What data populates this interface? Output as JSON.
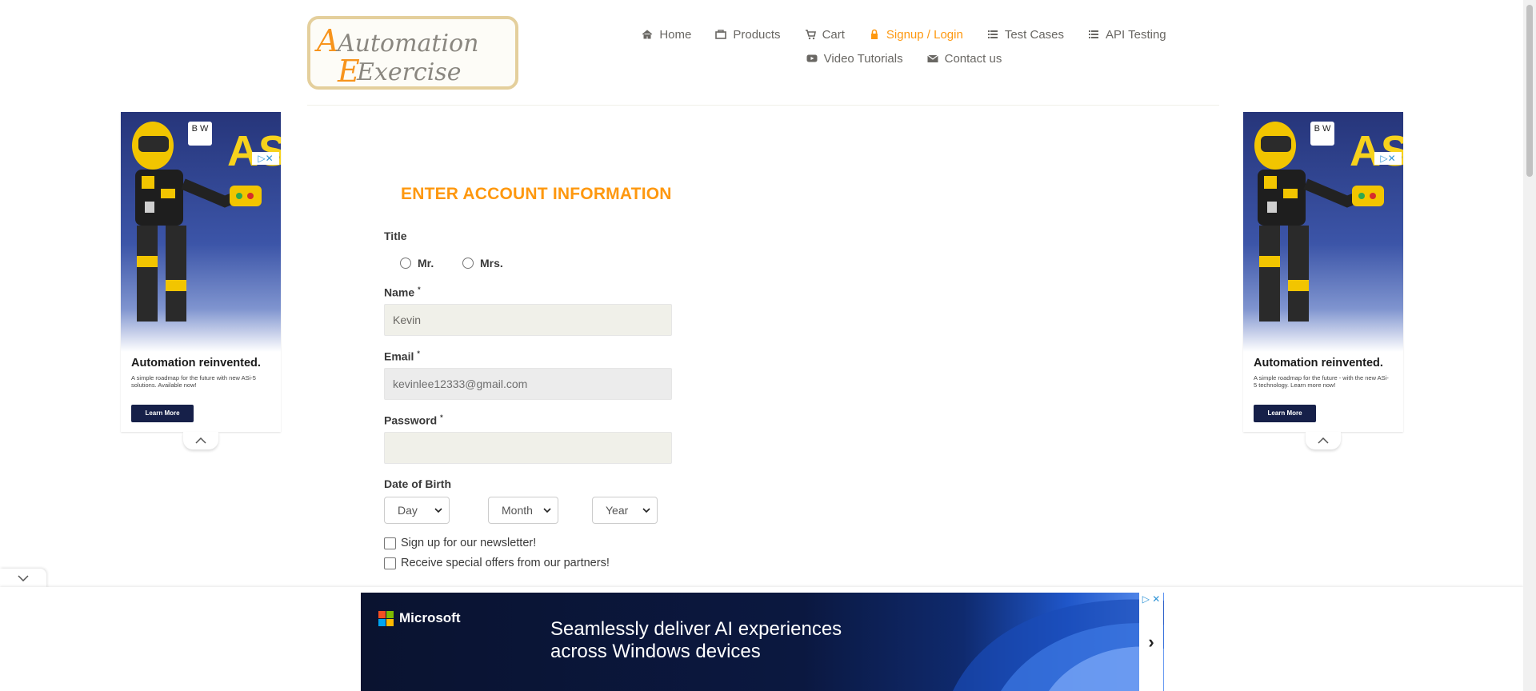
{
  "header": {
    "logo_text_line1": "Automation",
    "logo_text_line2": "Exercise",
    "nav": {
      "row1": [
        {
          "label": "Home",
          "icon": "home-icon"
        },
        {
          "label": "Products",
          "icon": "products-icon"
        },
        {
          "label": "Cart",
          "icon": "cart-icon"
        },
        {
          "label": "Signup / Login",
          "icon": "lock-icon",
          "active": true
        },
        {
          "label": "Test Cases",
          "icon": "list-icon"
        },
        {
          "label": "API Testing",
          "icon": "list-icon"
        }
      ],
      "row2": [
        {
          "label": "Video Tutorials",
          "icon": "youtube-icon"
        },
        {
          "label": "Contact us",
          "icon": "envelope-icon"
        }
      ]
    }
  },
  "side_ads": {
    "left": {
      "brand": "AS",
      "badge": "B W",
      "title": "Automation reinvented.",
      "subtitle": "A simple roadmap for the future with new ASi-5 solutions. Available now!",
      "button": "Learn More"
    },
    "right": {
      "brand": "AS",
      "badge": "B W",
      "title": "Automation reinvented.",
      "subtitle": "A simple roadmap for the future - with the new ASi-5 technology. Learn more now!",
      "button": "Learn More"
    }
  },
  "form": {
    "title": "ENTER ACCOUNT INFORMATION",
    "title_label": "Title",
    "title_options": [
      "Mr.",
      "Mrs."
    ],
    "name_label": "Name",
    "name_value": "Kevin",
    "email_label": "Email",
    "email_value": "kevinlee12333@gmail.com",
    "password_label": "Password",
    "password_value": "",
    "required_mark": "*",
    "dob_label": "Date of Birth",
    "dob": {
      "day": "Day",
      "month": "Month",
      "year": "Year"
    },
    "newsletter_label": "Sign up for our newsletter!",
    "offers_label": "Receive special offers from our partners!"
  },
  "bottom_ad": {
    "brand": "Microsoft",
    "headline": "Seamlessly deliver AI experiences across Windows devices",
    "next": "›"
  },
  "colors": {
    "accent": "#fe980f",
    "text": "#696763",
    "input_bg": "#f0f0e9"
  }
}
